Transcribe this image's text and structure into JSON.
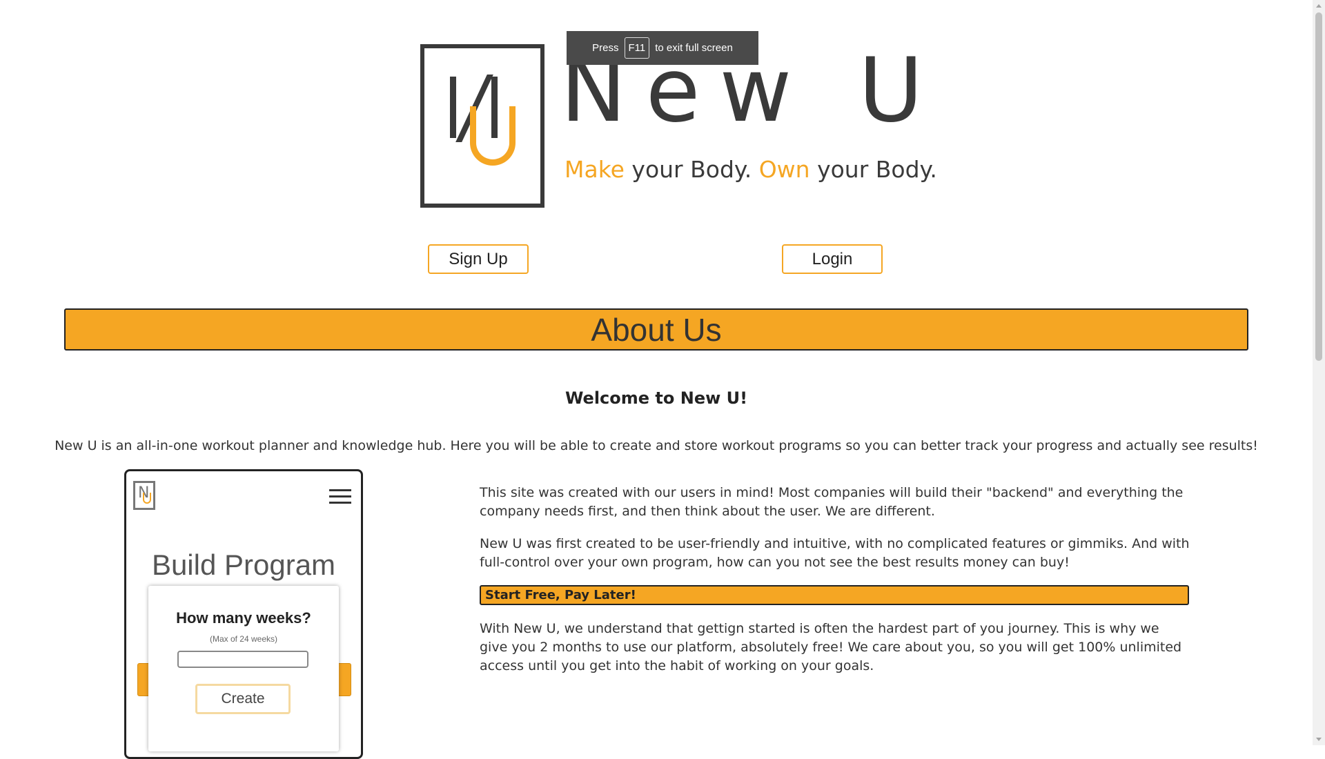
{
  "brand": {
    "logo_letters": "NU",
    "name": "New U",
    "tagline": {
      "word1": "Make",
      "rest1": " your Body. ",
      "word2": "Own",
      "rest2": " your Body."
    }
  },
  "fullscreen_toast": {
    "prefix": "Press",
    "key": "F11",
    "suffix": "to exit full screen"
  },
  "auth": {
    "signup_label": "Sign Up",
    "login_label": "Login"
  },
  "about": {
    "title": "About Us",
    "welcome": "Welcome to New U!",
    "intro": "New U is an all-in-one workout planner and knowledge hub. Here you will be able to create and store workout programs so you can better track your progress and actually see results!",
    "paragraph1": "This site was created with our users in mind! Most companies will build their \"backend\" and everything the company needs first, and then think about the user. We are different.",
    "paragraph2": "New U was first created to be user-friendly and intuitive, with no complicated features or gimmiks. And with full-control over your own program, how can you not see the best results money can buy!",
    "cta": "Start Free, Pay Later!",
    "paragraph3": "With New U, we understand that gettign started is often the hardest part of you journey. This is why we give you 2 months to use our platform, absolutely free! We care about you, so you will get 100% unlimited access until you get into the habit of working on your goals."
  },
  "mockup": {
    "title": "Build Program",
    "question": "How many weeks?",
    "note": "(Max of 24 weeks)",
    "input_value": "",
    "create_label": "Create"
  },
  "colors": {
    "accent": "#f5a623",
    "dark": "#3a3a3a"
  },
  "icons": [
    "hamburger-menu-icon",
    "logo-mark"
  ]
}
